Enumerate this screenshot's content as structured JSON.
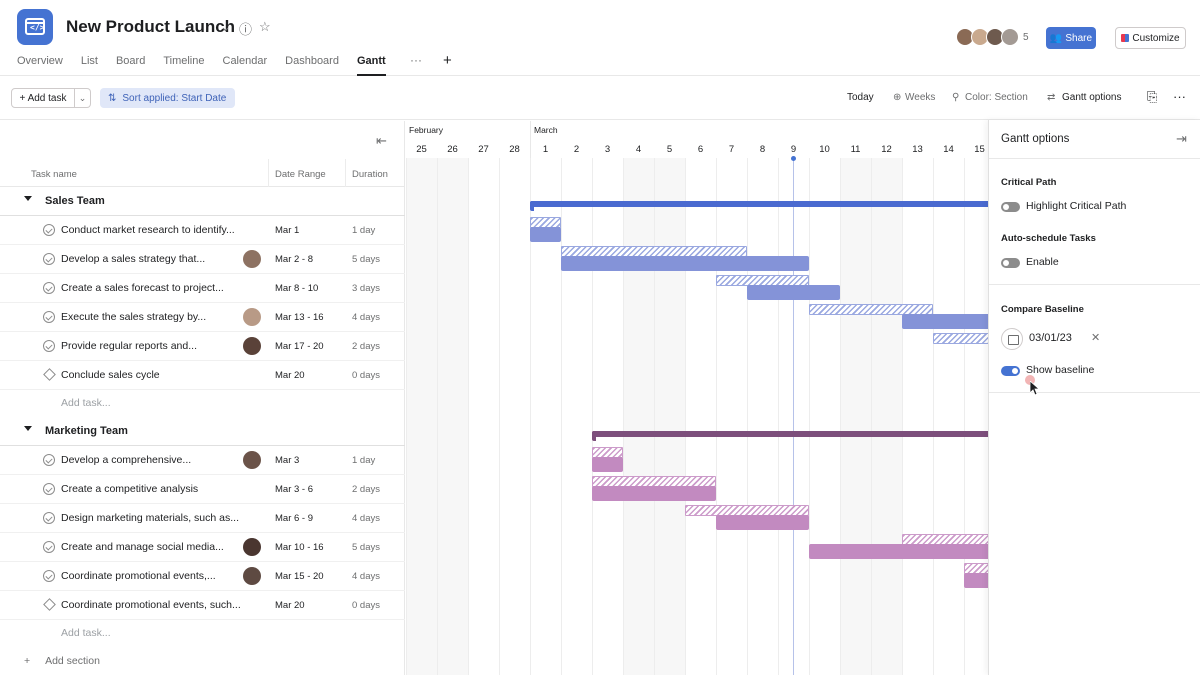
{
  "project": {
    "title": "New Product Launch"
  },
  "tabs": [
    "Overview",
    "List",
    "Board",
    "Timeline",
    "Calendar",
    "Dashboard",
    "Gantt"
  ],
  "header": {
    "member_count": "5",
    "share_label": "Share",
    "customize_label": "Customize"
  },
  "toolbar": {
    "add_task": "+ Add task",
    "sort_chip": "Sort applied: Start Date",
    "today": "Today",
    "weeks": "Weeks",
    "color": "Color: Section",
    "gantt_options": "Gantt options"
  },
  "columns": {
    "task_name": "Task name",
    "date_range": "Date Range",
    "duration": "Duration"
  },
  "timeline": {
    "months": [
      "February",
      "March"
    ],
    "days": [
      "25",
      "26",
      "27",
      "28",
      "1",
      "2",
      "3",
      "4",
      "5",
      "6",
      "7",
      "8",
      "9",
      "10",
      "11",
      "12",
      "13",
      "14",
      "15"
    ]
  },
  "sections": [
    {
      "name": "Sales Team",
      "tasks": [
        {
          "name": "Conduct market research to identify...",
          "date": "Mar 1",
          "duration": "1 day"
        },
        {
          "name": "Develop a sales strategy that...",
          "date": "Mar 2 - 8",
          "duration": "5 days"
        },
        {
          "name": "Create a sales forecast to project...",
          "date": "Mar 8 - 10",
          "duration": "3 days"
        },
        {
          "name": "Execute the sales strategy by...",
          "date": "Mar 13 - 16",
          "duration": "4 days"
        },
        {
          "name": "Provide regular reports and...",
          "date": "Mar 17 - 20",
          "duration": "2 days"
        },
        {
          "name": "Conclude sales cycle",
          "date": "Mar 20",
          "duration": "0 days"
        }
      ],
      "add_task": "Add task..."
    },
    {
      "name": "Marketing Team",
      "tasks": [
        {
          "name": "Develop a comprehensive...",
          "date": "Mar 3",
          "duration": "1 day"
        },
        {
          "name": "Create a competitive analysis",
          "date": "Mar 3 - 6",
          "duration": "2 days"
        },
        {
          "name": "Design marketing materials, such as...",
          "date": "Mar 6 - 9",
          "duration": "4 days"
        },
        {
          "name": "Create and manage social media...",
          "date": "Mar 10 - 16",
          "duration": "5 days"
        },
        {
          "name": "Coordinate promotional events,...",
          "date": "Mar 15 - 20",
          "duration": "4 days"
        },
        {
          "name": "Coordinate promotional events, such...",
          "date": "Mar 20",
          "duration": "0 days"
        }
      ],
      "add_task": "Add task..."
    }
  ],
  "add_section": "Add section",
  "panel": {
    "title": "Gantt options",
    "critical_path": "Critical Path",
    "highlight_critical_path": "Highlight Critical Path",
    "auto_schedule": "Auto-schedule Tasks",
    "enable": "Enable",
    "compare_baseline": "Compare Baseline",
    "baseline_date": "03/01/23",
    "show_baseline": "Show baseline"
  },
  "colors": {
    "accent": "#4573d2",
    "sales_bar": "#8493d8",
    "marketing_bar": "#c28ac0",
    "marketing_summary": "#7d4f7c"
  }
}
